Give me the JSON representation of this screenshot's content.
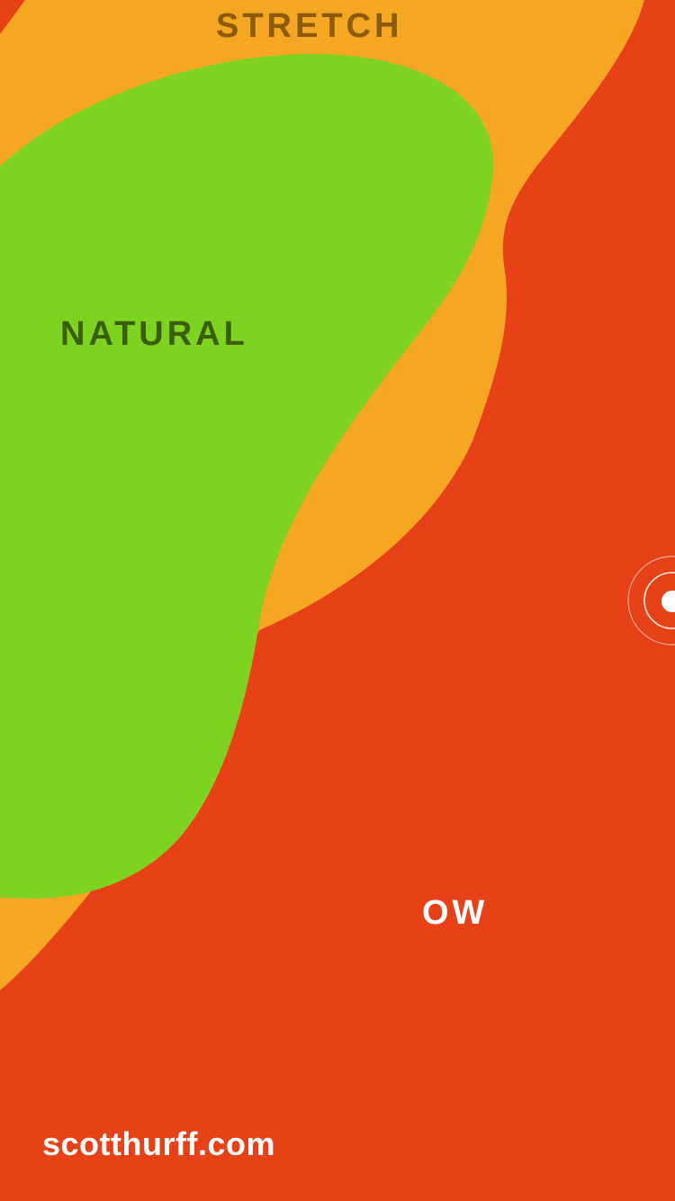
{
  "colors": {
    "background": "#e64117",
    "orange_blob": "#f5a623",
    "green_blob": "#7ed321",
    "stretch_text": "#8b5a0a",
    "natural_text": "#3b5e0d",
    "ow_text": "#ffffff",
    "link_text": "#ffffff",
    "indicator": "#ffffff"
  },
  "labels": {
    "stretch": "STRETCH",
    "natural": "NATURAL",
    "ow": "OW"
  },
  "footer": {
    "site_link": "scotthurff.com"
  },
  "indicator": {
    "icon": "touch-ripple-icon"
  }
}
